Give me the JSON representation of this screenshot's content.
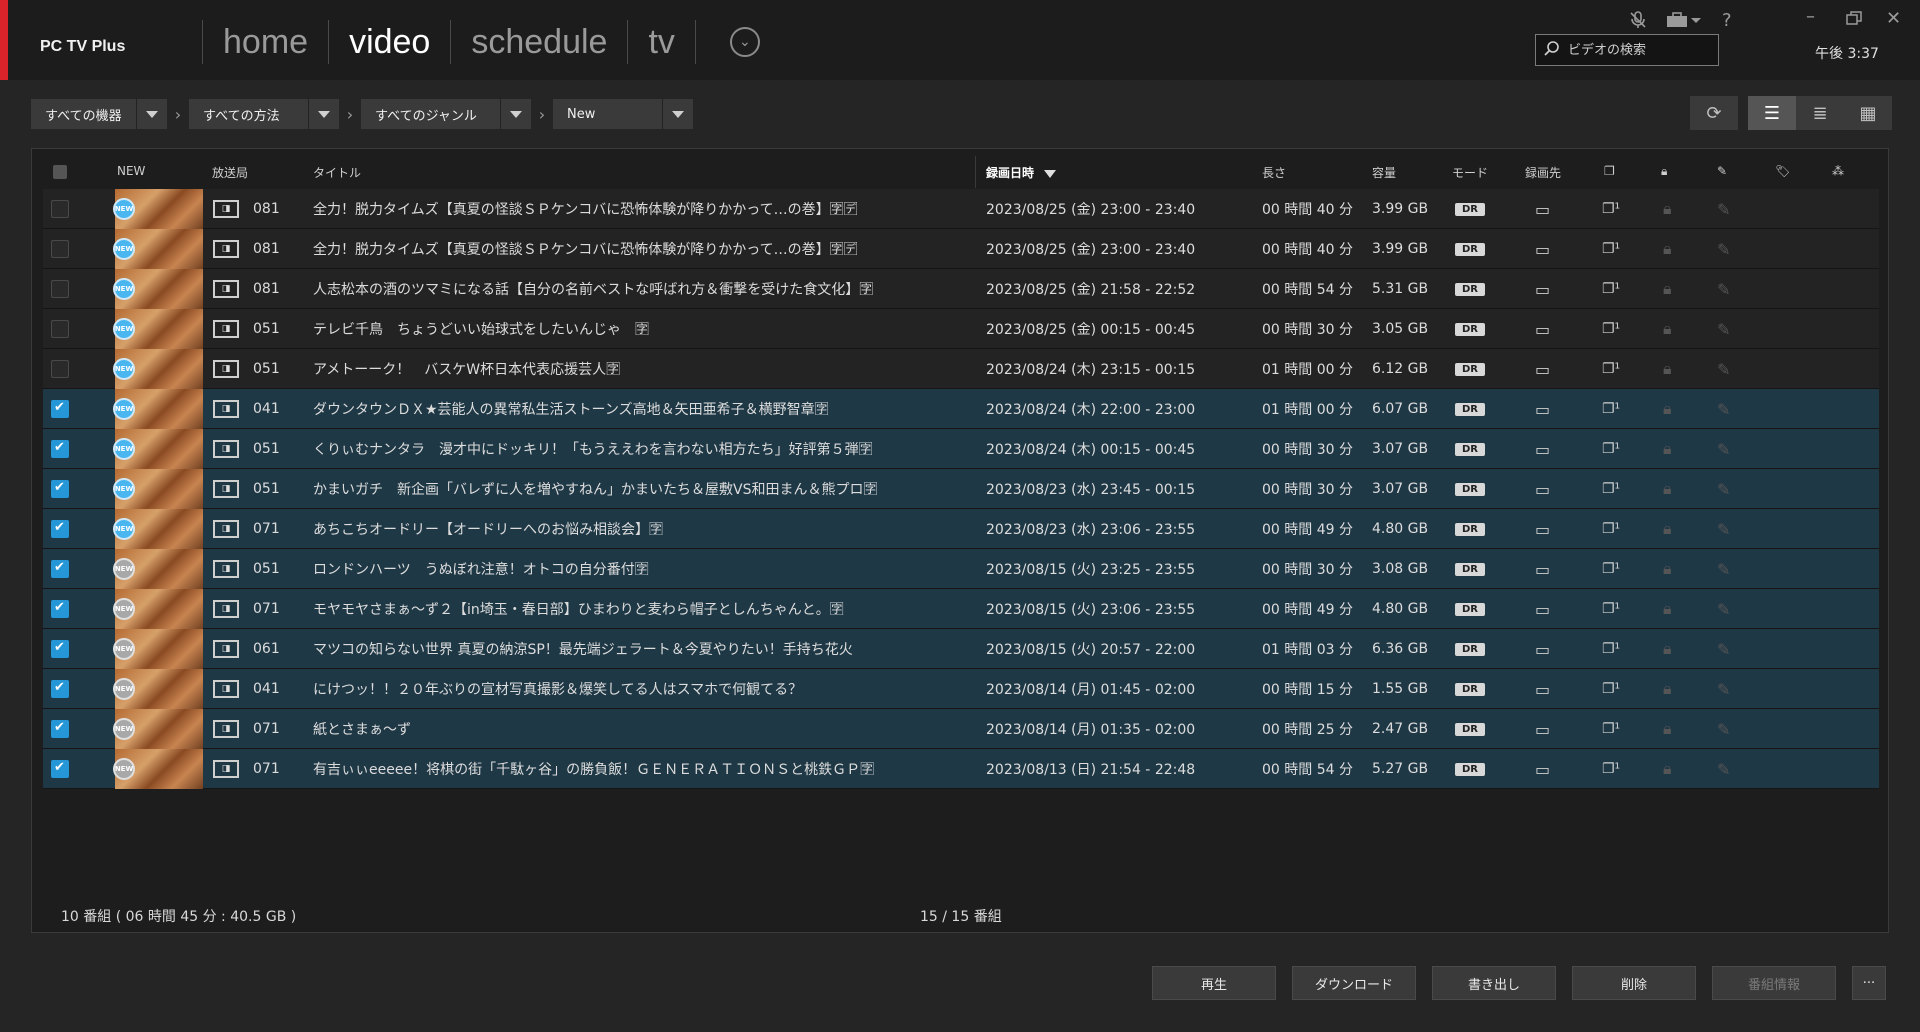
{
  "app": {
    "title": "PC TV Plus",
    "clock": "午後 3:37"
  },
  "nav": {
    "tabs": [
      "home",
      "video",
      "schedule",
      "tv"
    ],
    "active": "video"
  },
  "search": {
    "placeholder": "ビデオの検索"
  },
  "filters": [
    {
      "label": "すべての機器"
    },
    {
      "label": "すべての方法"
    },
    {
      "label": "すべてのジャンル"
    },
    {
      "label": "New"
    }
  ],
  "columns": {
    "new": "NEW",
    "station": "放送局",
    "title": "タイトル",
    "date": "録画日時",
    "length": "長さ",
    "size": "容量",
    "mode": "モード",
    "dest": "録画先"
  },
  "rows": [
    {
      "checked": false,
      "new_active": true,
      "ch": "081",
      "title": "全力！脱力タイムズ【真夏の怪談ＳＰケンコバに恐怖体験が降りかかって…の巻】🈑🈓",
      "date": "2023/08/25 (金) 23:00 - 23:40",
      "length": "00 時間 40 分",
      "size": "3.99 GB",
      "mode": "DR"
    },
    {
      "checked": false,
      "new_active": true,
      "ch": "081",
      "title": "全力！脱力タイムズ【真夏の怪談ＳＰケンコバに恐怖体験が降りかかって…の巻】🈑🈓",
      "date": "2023/08/25 (金) 23:00 - 23:40",
      "length": "00 時間 40 分",
      "size": "3.99 GB",
      "mode": "DR"
    },
    {
      "checked": false,
      "new_active": true,
      "ch": "081",
      "title": "人志松本の酒のツマミになる話【自分の名前ベストな呼ばれ方＆衝撃を受けた食文化】🈑",
      "date": "2023/08/25 (金) 21:58 - 22:52",
      "length": "00 時間 54 分",
      "size": "5.31 GB",
      "mode": "DR"
    },
    {
      "checked": false,
      "new_active": true,
      "ch": "051",
      "title": "テレビ千鳥　ちょうどいい始球式をしたいんじゃ　🈑",
      "date": "2023/08/25 (金) 00:15 - 00:45",
      "length": "00 時間 30 分",
      "size": "3.05 GB",
      "mode": "DR"
    },
    {
      "checked": false,
      "new_active": true,
      "ch": "051",
      "title": "アメトーーク！　バスケW杯日本代表応援芸人🈑",
      "date": "2023/08/24 (木) 23:15 - 00:15",
      "length": "01 時間 00 分",
      "size": "6.12 GB",
      "mode": "DR"
    },
    {
      "checked": true,
      "new_active": true,
      "ch": "041",
      "title": "ダウンタウンＤＸ★芸能人の異常私生活ストーンズ高地＆矢田亜希子＆横野智章🈑",
      "date": "2023/08/24 (木) 22:00 - 23:00",
      "length": "01 時間 00 分",
      "size": "6.07 GB",
      "mode": "DR"
    },
    {
      "checked": true,
      "new_active": true,
      "ch": "051",
      "title": "くりぃむナンタラ　漫才中にドッキリ！「もうええわを言わない相方たち」好評第５弾🈑",
      "date": "2023/08/24 (木) 00:15 - 00:45",
      "length": "00 時間 30 分",
      "size": "3.07 GB",
      "mode": "DR"
    },
    {
      "checked": true,
      "new_active": true,
      "ch": "051",
      "title": "かまいガチ　新企画「バレずに人を増やすねん」かまいたち＆屋敷VS和田まん＆熊プロ🈑",
      "date": "2023/08/23 (水) 23:45 - 00:15",
      "length": "00 時間 30 分",
      "size": "3.07 GB",
      "mode": "DR"
    },
    {
      "checked": true,
      "new_active": true,
      "ch": "071",
      "title": "あちこちオードリー【オードリーへのお悩み相談会】🈑",
      "date": "2023/08/23 (水) 23:06 - 23:55",
      "length": "00 時間 49 分",
      "size": "4.80 GB",
      "mode": "DR"
    },
    {
      "checked": true,
      "new_active": false,
      "ch": "051",
      "title": "ロンドンハーツ　うぬぼれ注意！オトコの自分番付🈑",
      "date": "2023/08/15 (火) 23:25 - 23:55",
      "length": "00 時間 30 分",
      "size": "3.08 GB",
      "mode": "DR"
    },
    {
      "checked": true,
      "new_active": false,
      "ch": "071",
      "title": "モヤモヤさまぁ～ず２【in埼玉・春日部】ひまわりと麦わら帽子としんちゃんと。🈑",
      "date": "2023/08/15 (火) 23:06 - 23:55",
      "length": "00 時間 49 分",
      "size": "4.80 GB",
      "mode": "DR"
    },
    {
      "checked": true,
      "new_active": false,
      "ch": "061",
      "title": "マツコの知らない世界 真夏の納涼SP！最先端ジェラート＆今夏やりたい！手持ち花火",
      "date": "2023/08/15 (火) 20:57 - 22:00",
      "length": "01 時間 03 分",
      "size": "6.36 GB",
      "mode": "DR"
    },
    {
      "checked": true,
      "new_active": false,
      "ch": "041",
      "title": "にけつッ！！２０年ぶりの宣材写真撮影＆爆笑してる人はスマホで何観てる？",
      "date": "2023/08/14 (月) 01:45 - 02:00",
      "length": "00 時間 15 分",
      "size": "1.55 GB",
      "mode": "DR"
    },
    {
      "checked": true,
      "new_active": false,
      "ch": "071",
      "title": "紙とさまぁ～ず",
      "date": "2023/08/14 (月) 01:35 - 02:00",
      "length": "00 時間 25 分",
      "size": "2.47 GB",
      "mode": "DR"
    },
    {
      "checked": true,
      "new_active": false,
      "ch": "071",
      "title": "有吉ぃぃeeeee！将棋の街「千駄ヶ谷」の勝負飯！ＧＥＮＥＲＡＴＩＯＮＳと桃鉄ＧＰ🈑",
      "date": "2023/08/13 (日) 21:54 - 22:48",
      "length": "00 時間 54 分",
      "size": "5.27 GB",
      "mode": "DR"
    }
  ],
  "footer": {
    "summary": "10 番組 ( 06 時間 45 分 : 40.5 GB )",
    "count": "15 / 15 番組"
  },
  "buttons": {
    "play": "再生",
    "download": "ダウンロード",
    "export": "書き出し",
    "delete": "削除",
    "info": "番組情報",
    "more": "···"
  },
  "colors": {
    "accent_red": "#d8232a",
    "selected_row": "#1f3846",
    "checkbox_on": "#2596d6",
    "new_badge": "#4ab6f0"
  },
  "icons": {
    "mic_off": "mic-off-icon",
    "briefcase": "briefcase-icon",
    "help": "help-icon",
    "minimize": "minimize-icon",
    "restore": "restore-icon",
    "close": "close-icon"
  }
}
